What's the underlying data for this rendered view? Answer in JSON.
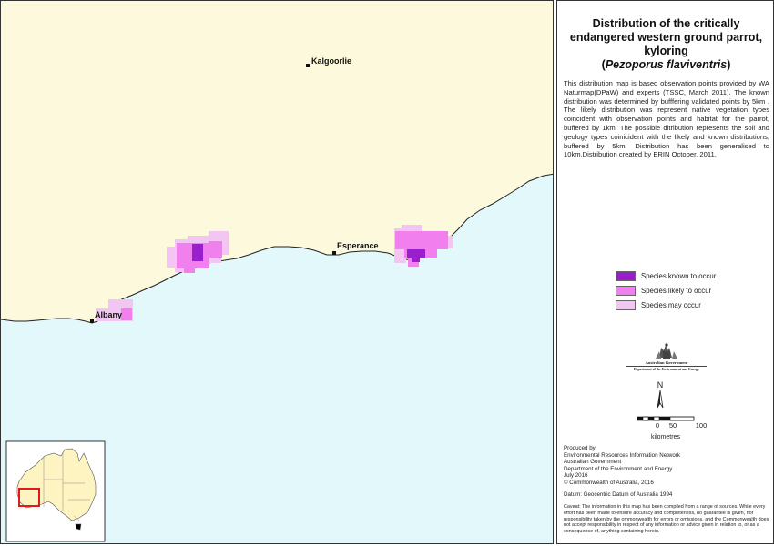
{
  "title": {
    "line1": "Distribution of the critically",
    "line2": "endangered western ground parrot,",
    "line3": "kyloring",
    "scientific_name": "Pezoporus flaviventris",
    "open_paren": "(",
    "close_paren": ")"
  },
  "description": "This distribution map is based observation points provided by WA Naturmap(DPaW) and  experts (TSSC, March 2011). The known distribution was determined by bufffering validated points by 5km .  The likely distribution was represent native vegetation types coincident with observation points and habitat for the parrot, buffered by 1km. The possible ditribution represents the soil and geology types coinicident with the likely and known distributions, buffered by 5km. Distribution has been generalised to 10km.Distribution created by ERIN October, 2011.",
  "map": {
    "colors": {
      "land": "#fdf9dc",
      "sea": "#e3f8fb",
      "coast": "#222222",
      "known": "#9a1fcc",
      "likely": "#f17fee",
      "may": "#f2c5f2"
    },
    "towns": [
      {
        "name": "Kalgoorlie"
      },
      {
        "name": "Esperance"
      },
      {
        "name": "Albany"
      }
    ],
    "inset": {
      "land_color": "#fdf4c2",
      "highlight_color": "#e01b1b"
    }
  },
  "legend": {
    "items": [
      {
        "label": "Species known to occur",
        "color": "#9a1fcc"
      },
      {
        "label": "Species likely to occur",
        "color": "#f17fee"
      },
      {
        "label": "Species may occur",
        "color": "#f2c5f2"
      }
    ]
  },
  "logo": {
    "government": "Australian Government",
    "department": "Department of the Environment and Energy"
  },
  "north_label": "N",
  "scale": {
    "ticks": [
      "0",
      "50",
      "100"
    ],
    "unit": "kilometres"
  },
  "produced": {
    "lines": [
      "Produced by:",
      "Environmental Resources Information Network",
      "Australian Government",
      "Department of the Environment and Energy",
      "July 2016",
      "© Commonwealth of Australia, 2016"
    ]
  },
  "datum": "Datum: Geocentric Datum of Australia 1994",
  "caveat": "Caveat:  The information in this map has been compiled from a range of sources. While every effort has been made to ensure accuracy and completeness, no guarantee is given, nor responsibility taken by the ommonwealth for errors or omissions, and the Commonwealth does not accept responsibility in respect of any information or advice given in relation to, or as a consequence of, anything containing herein."
}
